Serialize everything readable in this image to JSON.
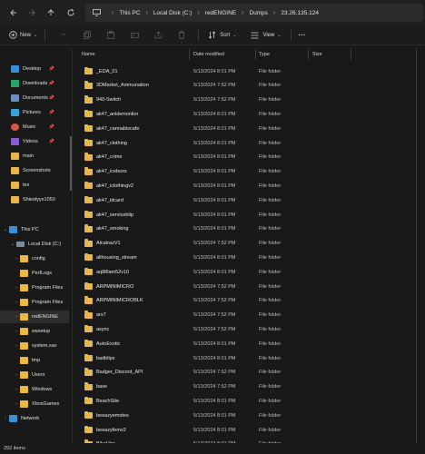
{
  "nav": {
    "back_icon": "arrow-left-icon",
    "forward_icon": "arrow-right-icon",
    "up_icon": "arrow-up-icon",
    "refresh_icon": "refresh-icon"
  },
  "address": {
    "crumbs": [
      "This PC",
      "Local Disk (C:)",
      "redENGINE",
      "Dumps",
      "23.26.135.124"
    ]
  },
  "toolbar": {
    "new_label": "New",
    "sort_label": "Sort",
    "view_label": "View",
    "more_label": "···"
  },
  "sidebar": {
    "quick": [
      {
        "label": "Desktop",
        "color": "#3a8fd6"
      },
      {
        "label": "Downloads",
        "color": "#2aa36a"
      },
      {
        "label": "Documents",
        "color": "#6c8ebf"
      },
      {
        "label": "Pictures",
        "color": "#3aa0d8"
      },
      {
        "label": "Music",
        "color": "#d2584a"
      },
      {
        "label": "Videos",
        "color": "#8a5ad1"
      },
      {
        "label": "main",
        "color": "#e8b64b"
      },
      {
        "label": "Screenshots",
        "color": "#e8b64b"
      },
      {
        "label": "tex",
        "color": "#e8b64b"
      },
      {
        "label": "Shiestyys1050",
        "color": "#e8b64b"
      }
    ],
    "this_pc": "This PC",
    "local_disk": "Local Disk (C:)",
    "folders": [
      "config",
      "PerfLogs",
      "Program Files",
      "Program Files",
      "redENGINE",
      "swsetup",
      "system.sav",
      "tmp",
      "Users",
      "Windows",
      "XboxGames"
    ],
    "network": "Network"
  },
  "columns": {
    "name": "Name",
    "date": "Date modified",
    "type": "Type",
    "size": "Size"
  },
  "files": [
    {
      "name": "_EDA_01",
      "date": "5/13/2024 8:01 PM",
      "type": "File folder"
    },
    {
      "name": "3DMarket_Ammunation",
      "date": "5/13/2024 7:52 PM",
      "type": "File folder"
    },
    {
      "name": "940-Switch",
      "date": "5/13/2024 7:52 PM",
      "type": "File folder"
    },
    {
      "name": "ak47_anklemonitor",
      "date": "5/13/2024 8:01 PM",
      "type": "File folder"
    },
    {
      "name": "ak47_cannabiscafe",
      "date": "5/13/2024 8:01 PM",
      "type": "File folder"
    },
    {
      "name": "ak47_clothing",
      "date": "5/13/2024 8:01 PM",
      "type": "File folder"
    },
    {
      "name": "ak47_crime",
      "date": "5/13/2024 8:01 PM",
      "type": "File folder"
    },
    {
      "name": "ak47_iceboxs",
      "date": "5/13/2024 8:01 PM",
      "type": "File folder"
    },
    {
      "name": "ak47_iclothingv2",
      "date": "5/13/2024 8:01 PM",
      "type": "File folder"
    },
    {
      "name": "ak47_idcard",
      "date": "5/13/2024 8:01 PM",
      "type": "File folder"
    },
    {
      "name": "ak47_serviceblip",
      "date": "5/13/2024 8:01 PM",
      "type": "File folder"
    },
    {
      "name": "ak47_smoking",
      "date": "5/13/2024 8:01 PM",
      "type": "File folder"
    },
    {
      "name": "AlcatrazV1",
      "date": "5/13/2024 7:52 PM",
      "type": "File folder"
    },
    {
      "name": "allhousing_stream",
      "date": "5/13/2024 8:01 PM",
      "type": "File folder"
    },
    {
      "name": "aq88lam52v10",
      "date": "5/13/2024 8:01 PM",
      "type": "File folder"
    },
    {
      "name": "ARPMINIMICRO",
      "date": "5/13/2024 7:52 PM",
      "type": "File folder"
    },
    {
      "name": "ARPMINIMICROBLK",
      "date": "5/13/2024 7:52 PM",
      "type": "File folder"
    },
    {
      "name": "ars7",
      "date": "5/13/2024 7:52 PM",
      "type": "File folder"
    },
    {
      "name": "async",
      "date": "5/13/2024 7:52 PM",
      "type": "File folder"
    },
    {
      "name": "AutoExotic",
      "date": "5/13/2024 8:01 PM",
      "type": "File folder"
    },
    {
      "name": "badblips",
      "date": "5/13/2024 8:01 PM",
      "type": "File folder"
    },
    {
      "name": "Badger_Discord_API",
      "date": "5/13/2024 7:52 PM",
      "type": "File folder"
    },
    {
      "name": "base",
      "date": "5/13/2024 7:52 PM",
      "type": "File folder"
    },
    {
      "name": "BeachSite",
      "date": "5/13/2024 8:01 PM",
      "type": "File folder"
    },
    {
      "name": "beeazyemotes",
      "date": "5/13/2024 8:01 PM",
      "type": "File folder"
    },
    {
      "name": "beeazyfemv2",
      "date": "5/13/2024 8:01 PM",
      "type": "File folder"
    },
    {
      "name": "BikeHire",
      "date": "5/13/2024 8:01 PM",
      "type": "File folder"
    }
  ],
  "status": {
    "count": "292 items"
  }
}
